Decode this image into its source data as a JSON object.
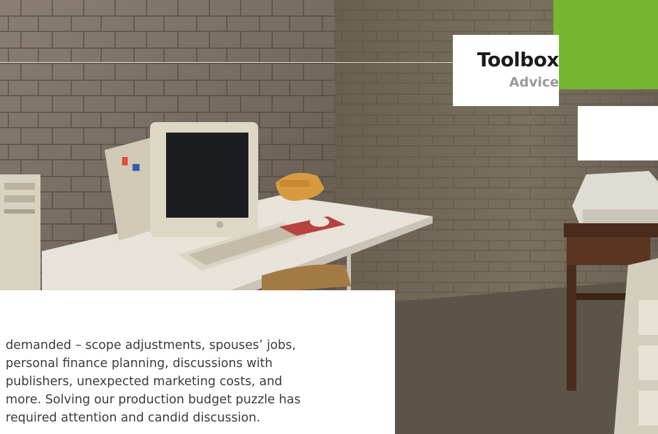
{
  "badge": {
    "title": "Toolbox",
    "subtitle": "Advice"
  },
  "article": {
    "lines": [
      "demanded – scope adjustments, spouses’ jobs,",
      "personal finance planning, discussions with",
      "publishers, unexpected marketing costs, and",
      "more. Solving our production budget puzzle has",
      "required attention and candid discussion."
    ]
  },
  "colors": {
    "accent_green": "#79b62f",
    "badge_subtitle": "#9a9a9a",
    "body_text": "#3b3b3b"
  },
  "photo": {
    "objects": [
      "stone-wall",
      "crt-monitor",
      "keyboard",
      "telephone",
      "mouse",
      "mousepad",
      "desk",
      "chair",
      "printer",
      "wooden-cabinet",
      "pc-tower",
      "dresser"
    ]
  }
}
